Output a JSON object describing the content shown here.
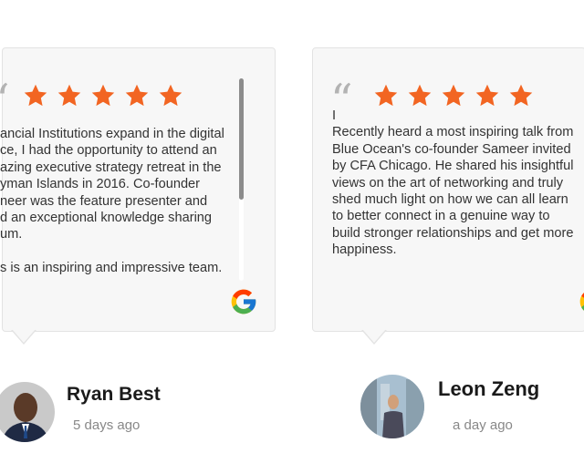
{
  "reviews": [
    {
      "quote_mark": "“",
      "rating": 5,
      "text_lines": [
        "ancial Institutions expand in the digital",
        "ce, I had the opportunity to attend an",
        "azing executive strategy retreat in the",
        "yman Islands in 2016. Co-founder",
        "neer was the feature presenter and",
        "d an exceptional knowledge sharing",
        "um.",
        "",
        "s is an inspiring and impressive team."
      ],
      "source_icon": "google-icon",
      "reviewer_name": "Ryan Best",
      "time_ago": "5 days ago"
    },
    {
      "quote_mark": "“",
      "rating": 5,
      "text_lines": [
        "I",
        "Recently heard a most inspiring talk from",
        "Blue Ocean's co-founder Sameer invited",
        "by CFA Chicago.  He shared his insightful",
        "views on the art of networking and truly",
        "shed much light on how we can all learn",
        "to better connect in a genuine way to",
        "build stronger relationships and get more",
        "happiness."
      ],
      "source_icon": "google-icon",
      "reviewer_name": "Leon Zeng",
      "time_ago": "a day ago"
    }
  ],
  "colors": {
    "star": "#f26522",
    "card_background": "#f7f7f7",
    "card_border": "#e3e3e3"
  }
}
